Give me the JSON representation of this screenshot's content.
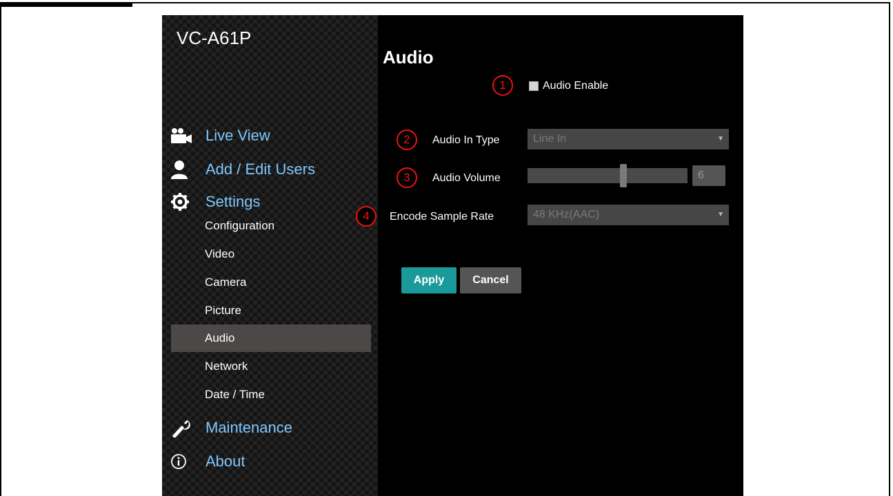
{
  "app": {
    "title": "VC-A61P"
  },
  "nav": {
    "main_top": [
      {
        "label": "Live View",
        "icon": "video-camera-icon"
      },
      {
        "label": "Add / Edit Users",
        "icon": "user-icon"
      },
      {
        "label": "Settings",
        "icon": "gear-icon"
      }
    ],
    "sub": [
      {
        "label": "Configuration"
      },
      {
        "label": "Video"
      },
      {
        "label": "Camera"
      },
      {
        "label": "Picture"
      },
      {
        "label": "Audio",
        "active": true
      },
      {
        "label": "Network"
      },
      {
        "label": "Date / Time"
      }
    ],
    "main_bottom": [
      {
        "label": "Maintenance",
        "icon": "wrench-icon"
      },
      {
        "label": "About",
        "icon": "info-icon"
      }
    ]
  },
  "page": {
    "title": "Audio",
    "markers": [
      "1",
      "2",
      "3",
      "4"
    ],
    "audio_enable": {
      "label": "Audio Enable",
      "checked": false
    },
    "audio_in_type": {
      "label": "Audio In Type",
      "value": "Line In"
    },
    "audio_volume": {
      "label": "Audio Volume",
      "value": "6",
      "level": 0.6
    },
    "encode_sample_rate": {
      "label": "Encode Sample Rate",
      "value": "48 KHz(AAC)"
    },
    "apply_label": "Apply",
    "cancel_label": "Cancel"
  },
  "colors": {
    "nav_text": "#7fc8ff",
    "marker": "#ee1111",
    "apply_button": "#1a9a9a",
    "cancel_button": "#555555",
    "active_nav": "#4c4848"
  }
}
